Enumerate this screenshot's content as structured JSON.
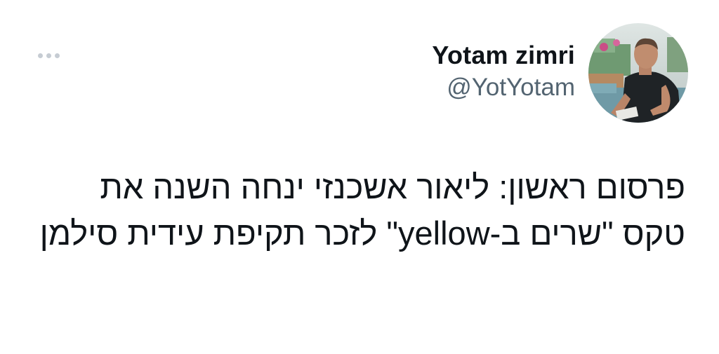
{
  "tweet": {
    "author": {
      "display_name": "Yotam zimri",
      "handle": "@YotYotam"
    },
    "more_icon": "more-horizontal-icon",
    "text": "פרסום ראשון: ליאור אשכנזי ינחה השנה את טקס \"שרים ב-yellow\" לזכר תקיפת עידית סילמן"
  }
}
